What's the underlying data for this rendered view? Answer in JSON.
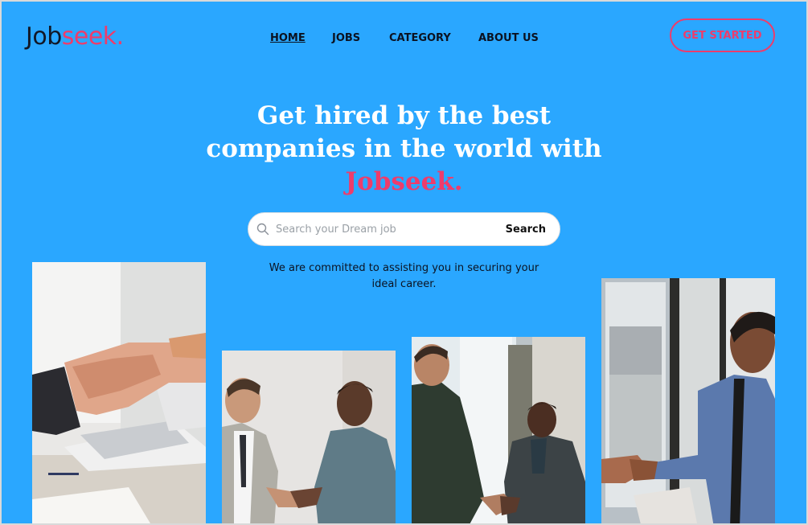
{
  "brand": {
    "logo_part1": "Job",
    "logo_part2": "seek.",
    "accent_color": "#ee3c6b",
    "background_color": "#2aa7ff"
  },
  "nav": {
    "items": [
      {
        "label": "HOME",
        "active": true
      },
      {
        "label": "JOBS",
        "active": false
      },
      {
        "label": "CATEGORY",
        "active": false
      },
      {
        "label": "ABOUT US",
        "active": false
      }
    ],
    "cta_label": "GET STARTED"
  },
  "hero": {
    "title_line1": "Get hired by the best",
    "title_line2": "companies in the world with",
    "title_brand": "Jobseek.",
    "subtitle_line1": "We are committed to assisting you in securing your",
    "subtitle_line2": "ideal career."
  },
  "search": {
    "placeholder": "Search your Dream job",
    "button_label": "Search",
    "icon": "search-icon"
  },
  "photos": [
    {
      "subject": "handshake over desk with laptop"
    },
    {
      "subject": "two men shaking hands in office"
    },
    {
      "subject": "two men shaking hands by window"
    },
    {
      "subject": "man shaking hands near window"
    }
  ]
}
